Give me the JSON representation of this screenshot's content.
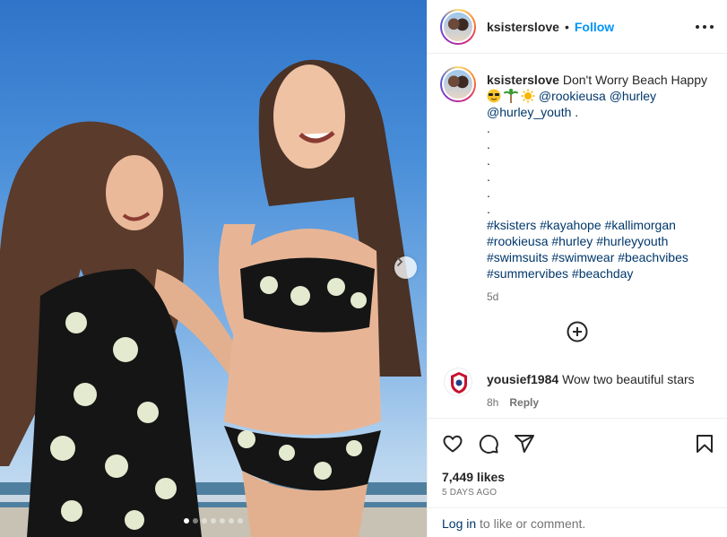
{
  "post": {
    "username": "ksisterslove",
    "follow_label": "Follow",
    "separator": "•"
  },
  "caption": {
    "username": "ksisterslove",
    "text": "Don't Worry Beach Happy",
    "emojis": [
      "smiling-face-with-sunglasses",
      "palm-tree",
      "sun"
    ],
    "mentions": [
      "@rookieusa",
      "@hurley",
      "@hurley_youth"
    ],
    "after_mentions": ".",
    "dots": [
      ".",
      ".",
      ".",
      ".",
      ".",
      "."
    ],
    "hashtags": [
      "#ksisters",
      "#kayahope",
      "#kallimorgan",
      "#rookieusa",
      "#hurley",
      "#hurleyyouth",
      "#swimsuits",
      "#swimwear",
      "#beachvibes",
      "#summervibes",
      "#beachday"
    ],
    "age": "5d"
  },
  "comment": {
    "username": "yousief1984",
    "text": "Wow two beautiful stars",
    "age": "8h",
    "reply_label": "Reply"
  },
  "engagement": {
    "likes": "7,449 likes",
    "date": "5 DAYS AGO"
  },
  "login_prompt": {
    "link": "Log in",
    "text": " to like or comment."
  },
  "carousel": {
    "slides": 7,
    "active_index": 0
  },
  "colors": {
    "accent": "#0095f6",
    "link": "#00376b",
    "muted": "#737373",
    "text": "#262626"
  }
}
